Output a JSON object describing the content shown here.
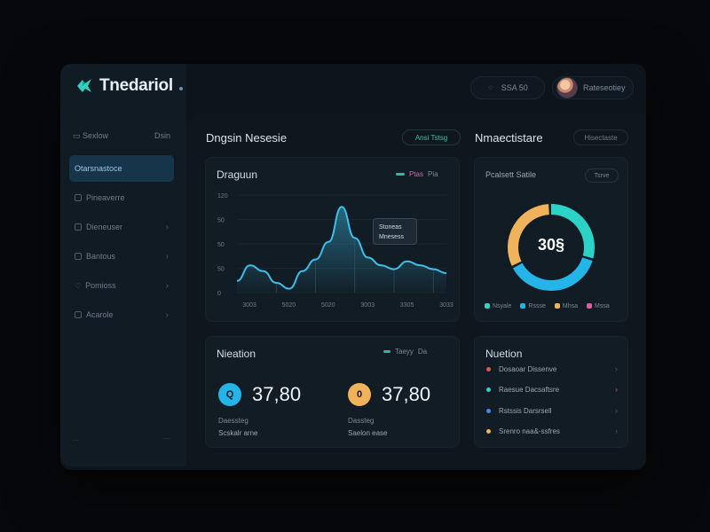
{
  "app": {
    "title": "Tnedariol"
  },
  "header": {
    "search_label": "SSA 50",
    "user_name": "Rateseotiey"
  },
  "sidebar": {
    "heading": "Sexlow",
    "heading_right": "Dsin",
    "items": [
      {
        "label": "Otarsnastoce",
        "active": true
      },
      {
        "label": "Pineaverre"
      },
      {
        "label": "Dieneuser"
      },
      {
        "label": "Bantous"
      },
      {
        "label": "Pomioss"
      },
      {
        "label": "Acarole"
      }
    ],
    "footer_left": "...",
    "footer_right": "---"
  },
  "main": {
    "section_left_title": "Dngsin Nesesie",
    "section_left_button": "Ansi Tstsg",
    "section_right_title": "Nmaectistare",
    "section_right_button": "Hisectaste"
  },
  "chart_card": {
    "title": "Draguun",
    "legend_a": "Ptas",
    "legend_b": "Pia",
    "tooltip_line1": "Stoneas",
    "tooltip_line2": "Mnesess"
  },
  "chart_data": {
    "type": "area",
    "x_ticks": [
      "3003",
      "5020",
      "5020",
      "3003",
      "3305",
      "3033"
    ],
    "y_ticks": [
      "120",
      "50",
      "50",
      "50",
      "0"
    ],
    "x": [
      0,
      1,
      2,
      3,
      4,
      5,
      6,
      7,
      8,
      9,
      10,
      11,
      12,
      13,
      14,
      15,
      16
    ],
    "values": [
      12,
      28,
      22,
      10,
      4,
      22,
      34,
      52,
      88,
      56,
      36,
      28,
      24,
      32,
      28,
      24,
      20
    ],
    "ylim": [
      0,
      100
    ],
    "series_color": "#3cc0ea"
  },
  "donut_card": {
    "title": "Pcalsett Satile",
    "badge": "Tsrve",
    "center_value": "30§",
    "segments": [
      {
        "label": "Nsyale",
        "value": 30,
        "color": "#2bd3c7"
      },
      {
        "label": "Rssse",
        "value": 38,
        "color": "#25b4e8"
      },
      {
        "label": "Mhsa",
        "value": 32,
        "color": "#f0b25a"
      }
    ],
    "legend_extra": "Mssa"
  },
  "stats_card": {
    "title": "Nieation",
    "legend_a": "Taeyy",
    "legend_b": "Da",
    "stat1": {
      "icon_letter": "Q",
      "value": "37,80",
      "label1": "Daessteg",
      "label2": "Scskalr arne",
      "color": "#25b4e8"
    },
    "stat2": {
      "icon_letter": "0",
      "value": "37,80",
      "label1": "Dassteg",
      "label2": "Saelon ease",
      "color": "#f0b25a"
    }
  },
  "list_card": {
    "title": "Nuetion",
    "items": [
      {
        "label": "Dosaoar Dissenve",
        "color": "#e0534f"
      },
      {
        "label": "Raesue Dacsaftsre",
        "color": "#2bd3c7"
      },
      {
        "label": "Rstssis Darsrsell",
        "color": "#3c8ee8"
      },
      {
        "label": "Srenro naa&-ssfres",
        "color": "#f0b25a"
      }
    ]
  }
}
